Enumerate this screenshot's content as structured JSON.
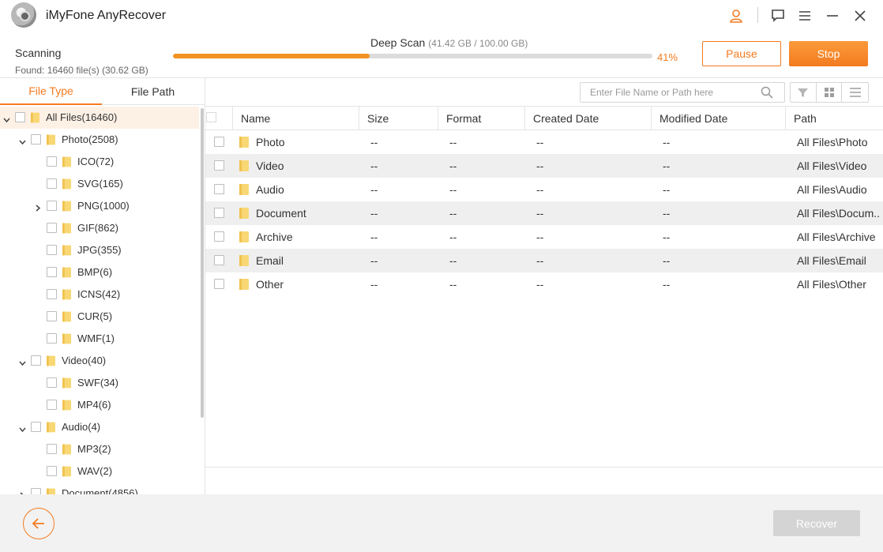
{
  "app": {
    "title": "iMyFone AnyRecover"
  },
  "scan": {
    "status": "Scanning",
    "found": "Found: 16460 file(s) (30.62 GB)",
    "mode": "Deep Scan",
    "mode_detail": "(41.42 GB / 100.00 GB)",
    "progress_percent": 41,
    "progress_label": "41%",
    "pause_label": "Pause",
    "stop_label": "Stop"
  },
  "left_tabs": [
    {
      "label": "File Type",
      "active": true
    },
    {
      "label": "File Path",
      "active": false
    }
  ],
  "tree": [
    {
      "label": "All Files(16460)",
      "level": 0,
      "arrow": "down",
      "selected": true
    },
    {
      "label": "Photo(2508)",
      "level": 1,
      "arrow": "down"
    },
    {
      "label": "ICO(72)",
      "level": 2,
      "arrow": ""
    },
    {
      "label": "SVG(165)",
      "level": 2,
      "arrow": ""
    },
    {
      "label": "PNG(1000)",
      "level": 2,
      "arrow": "right"
    },
    {
      "label": "GIF(862)",
      "level": 2,
      "arrow": ""
    },
    {
      "label": "JPG(355)",
      "level": 2,
      "arrow": ""
    },
    {
      "label": "BMP(6)",
      "level": 2,
      "arrow": ""
    },
    {
      "label": "ICNS(42)",
      "level": 2,
      "arrow": ""
    },
    {
      "label": "CUR(5)",
      "level": 2,
      "arrow": ""
    },
    {
      "label": "WMF(1)",
      "level": 2,
      "arrow": ""
    },
    {
      "label": "Video(40)",
      "level": 1,
      "arrow": "down"
    },
    {
      "label": "SWF(34)",
      "level": 2,
      "arrow": ""
    },
    {
      "label": "MP4(6)",
      "level": 2,
      "arrow": ""
    },
    {
      "label": "Audio(4)",
      "level": 1,
      "arrow": "down"
    },
    {
      "label": "MP3(2)",
      "level": 2,
      "arrow": ""
    },
    {
      "label": "WAV(2)",
      "level": 2,
      "arrow": ""
    },
    {
      "label": "Document(4856)",
      "level": 1,
      "arrow": "right"
    }
  ],
  "search": {
    "placeholder": "Enter File Name or Path here"
  },
  "table": {
    "columns": [
      "Name",
      "Size",
      "Format",
      "Created Date",
      "Modified Date",
      "Path"
    ],
    "rows": [
      [
        "Photo",
        "--",
        "--",
        "--",
        "--",
        "All Files\\Photo"
      ],
      [
        "Video",
        "--",
        "--",
        "--",
        "--",
        "All Files\\Video"
      ],
      [
        "Audio",
        "--",
        "--",
        "--",
        "--",
        "All Files\\Audio"
      ],
      [
        "Document",
        "--",
        "--",
        "--",
        "--",
        "All Files\\Docum..."
      ],
      [
        "Archive",
        "--",
        "--",
        "--",
        "--",
        "All Files\\Archive"
      ],
      [
        "Email",
        "--",
        "--",
        "--",
        "--",
        "All Files\\Email"
      ],
      [
        "Other",
        "--",
        "--",
        "--",
        "--",
        "All Files\\Other"
      ]
    ]
  },
  "footer": {
    "recover_label": "Recover"
  },
  "colors": {
    "accent": "#f47b20",
    "folder": "#f8d774",
    "disabled": "#d4d4d4"
  }
}
